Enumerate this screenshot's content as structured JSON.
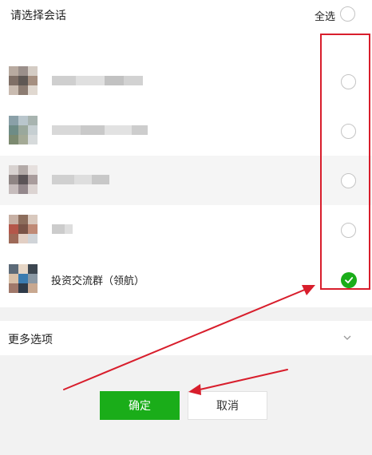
{
  "header": {
    "title": "请选择会话",
    "select_all_label": "全选"
  },
  "contacts": [
    {
      "name": "",
      "blurred": true,
      "selected": false
    },
    {
      "name": "",
      "blurred": true,
      "selected": false
    },
    {
      "name": "",
      "blurred": true,
      "selected": false
    },
    {
      "name": "",
      "blurred": true,
      "selected": false
    },
    {
      "name": "",
      "blurred": true,
      "selected": false
    },
    {
      "name": "投资交流群（领航）",
      "blurred": false,
      "selected": true
    }
  ],
  "more_options": {
    "label": "更多选项"
  },
  "buttons": {
    "confirm_label": "确定",
    "cancel_label": "取消"
  },
  "colors": {
    "accent": "#1aad19",
    "annotation": "#d81e2c",
    "avatar_palette": [
      "#a88878",
      "#7c8c94",
      "#c6b8ac",
      "#5e5f66",
      "#b7c2c8",
      "#9a7a64",
      "#d9cfc8",
      "#8e9a8a",
      "#b4574a",
      "#d0d4d8"
    ]
  },
  "icons": {
    "checkmark": "check-icon",
    "chevron": "chevron-down-icon"
  }
}
